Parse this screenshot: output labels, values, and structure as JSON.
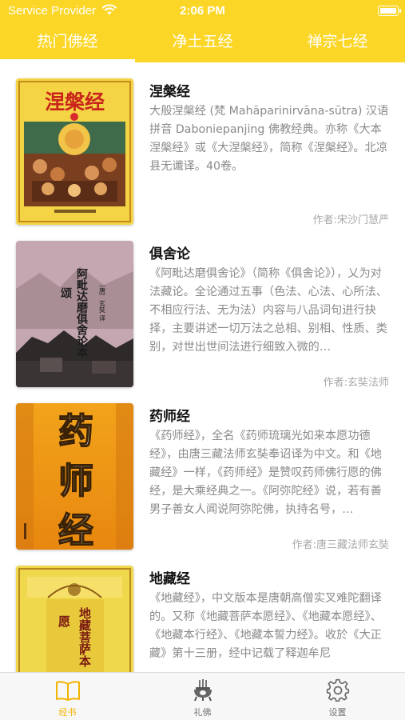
{
  "status_bar": {
    "carrier": "Service Provider",
    "time": "2:06 PM"
  },
  "tabs": [
    {
      "label": "热门佛经",
      "active": true
    },
    {
      "label": "净土五经",
      "active": false
    },
    {
      "label": "禅宗七经",
      "active": false
    }
  ],
  "books": [
    {
      "title": "涅槃经",
      "description": "大般涅槃经 (梵 Mahāparinirvāna-sūtra) 汉语拼音 Daboniepanjing 佛教经典。亦称《大本涅槃经》或《大涅槃经》，简称《涅槃经》。北凉县无谶译。40卷。",
      "author": "作者:宋沙门慧严",
      "cover_text": "涅槃经"
    },
    {
      "title": "俱舍论",
      "description": "《阿毗达磨俱舍论》（简称《俱舍论》），乂为对法藏论。全论通过五事（色法、心法、心所法、不相应行法、无为法）内容与八品词句进行抉择，主要讲述一切万法之总相、别相、性质、类别，对世出世间法进行细致入微的…",
      "author": "作者:玄奘法师",
      "cover_text": "阿毗达磨俱舍论本颂"
    },
    {
      "title": "药师经",
      "description": "《药师经》，全名《药师琉璃光如来本愿功德经》，由唐三藏法师玄奘奉诏译为中文。和《地藏经》一样，《药师经》是赞叹药师佛行愿的佛经，是大乘经典之一。《阿弥陀经》说，若有善男子善女人闻说阿弥陀佛，执持名号，…",
      "author": "作者:唐三藏法师玄奘",
      "cover_text": "药师经"
    },
    {
      "title": "地藏经",
      "description": "《地藏经》，中文版本是唐朝高僧实叉难陀翻译的。又称《地藏菩萨本愿经》、《地藏本愿经》、《地藏本行经》、《地藏本誓力经》。收於《大正藏》第十三册，经中记载了释迦牟尼",
      "author": "",
      "cover_text": "地藏菩萨本愿"
    }
  ],
  "tabbar": [
    {
      "label": "经书",
      "icon": "book-icon",
      "active": true
    },
    {
      "label": "礼佛",
      "icon": "incense-burner-icon",
      "active": false
    },
    {
      "label": "设置",
      "icon": "gear-icon",
      "active": false
    }
  ],
  "colors": {
    "accent": "#fcd626",
    "tab_active": "#f2b400",
    "text_gray": "#8a8a8a"
  }
}
